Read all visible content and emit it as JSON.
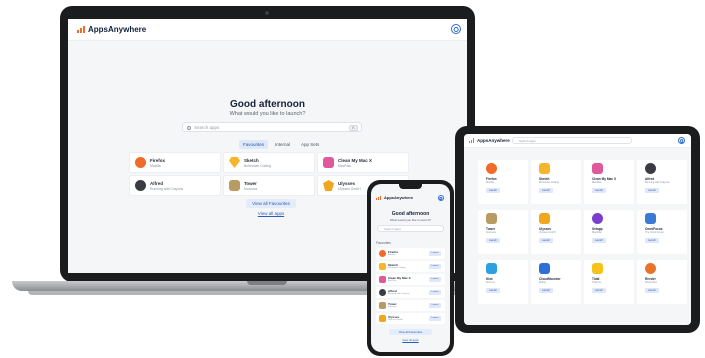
{
  "brand": {
    "name": "AppsAnywhere",
    "logo_color": "#f06a2a"
  },
  "laptop": {
    "greeting": "Good afternoon",
    "subtitle": "What would you like to launch?",
    "search": {
      "placeholder": "Search apps",
      "shortcut": "K"
    },
    "tabs": [
      {
        "label": "Favourites",
        "active": true
      },
      {
        "label": "Internal",
        "active": false
      },
      {
        "label": "App Sets",
        "active": false
      }
    ],
    "apps": [
      {
        "name": "Firefox",
        "subtitle": "Mozilla",
        "icon": "firefox-icon",
        "color": "#f06a2a"
      },
      {
        "name": "Sketch",
        "subtitle": "Bohemian Coding",
        "icon": "sketch-icon",
        "color": "#f7b52b"
      },
      {
        "name": "Clean My Mac X",
        "subtitle": "MacPaw",
        "icon": "cleanmymac-icon",
        "color": "#e05a9b"
      },
      {
        "name": "Alfred",
        "subtitle": "Running with Crayons",
        "icon": "alfred-icon",
        "color": "#3b3b44"
      },
      {
        "name": "Tower",
        "subtitle": "fournova",
        "icon": "tower-icon",
        "color": "#b89a63"
      },
      {
        "name": "Ulysses",
        "subtitle": "Ulysses GmbH",
        "icon": "ulysses-icon",
        "color": "#f2a61d"
      }
    ],
    "view_favourites": "View all Favourites",
    "view_apps": "View all apps"
  },
  "tablet": {
    "search_placeholder": "Search apps",
    "apps": [
      {
        "name": "Firefox",
        "subtitle": "Mozilla",
        "color": "#f06a2a"
      },
      {
        "name": "Sketch",
        "subtitle": "Bohemian Coding",
        "color": "#f7b52b"
      },
      {
        "name": "Clean My Mac X",
        "subtitle": "MacPaw",
        "color": "#e05a9b"
      },
      {
        "name": "Alfred",
        "subtitle": "Running with Crayons",
        "color": "#3b3b44"
      },
      {
        "name": "Tower",
        "subtitle": "fournova",
        "color": "#b89a63"
      },
      {
        "name": "Ulysses",
        "subtitle": "Ulysses GmbH",
        "color": "#f2a61d"
      },
      {
        "name": "Setapp",
        "subtitle": "MacPaw",
        "color": "#7b3fcf"
      },
      {
        "name": "OmniFocus",
        "subtitle": "The Omni Group",
        "color": "#3a7bd5"
      },
      {
        "name": "Kiwi",
        "subtitle": "Kiwi Ltd",
        "color": "#2ea0e0"
      },
      {
        "name": "CloudMounter",
        "subtitle": "Eltima",
        "color": "#2d6fd6"
      },
      {
        "name": "Tidal",
        "subtitle": "Tidal Inc",
        "color": "#f5c21b"
      },
      {
        "name": "Reeder",
        "subtitle": "Silvio Rizzi",
        "color": "#e8742a"
      }
    ],
    "launch_label": "Launch"
  },
  "phone": {
    "greeting": "Good afternoon",
    "subtitle": "What would you like to launch?",
    "search_placeholder": "Search apps",
    "section": "Favourites",
    "apps": [
      {
        "name": "Firefox",
        "subtitle": "Mozilla",
        "color": "#f06a2a"
      },
      {
        "name": "Sketch",
        "subtitle": "Bohemian Coding",
        "color": "#f7b52b"
      },
      {
        "name": "Clean My Mac X",
        "subtitle": "MacPaw",
        "color": "#e05a9b"
      },
      {
        "name": "Alfred",
        "subtitle": "Running with Crayons",
        "color": "#3b3b44"
      },
      {
        "name": "Tower",
        "subtitle": "fournova",
        "color": "#b89a63"
      },
      {
        "name": "Ulysses",
        "subtitle": "Ulysses GmbH",
        "color": "#f2a61d"
      }
    ],
    "launch_label": "Launch",
    "view_favourites": "View all Favourites",
    "view_apps": "View all apps"
  }
}
